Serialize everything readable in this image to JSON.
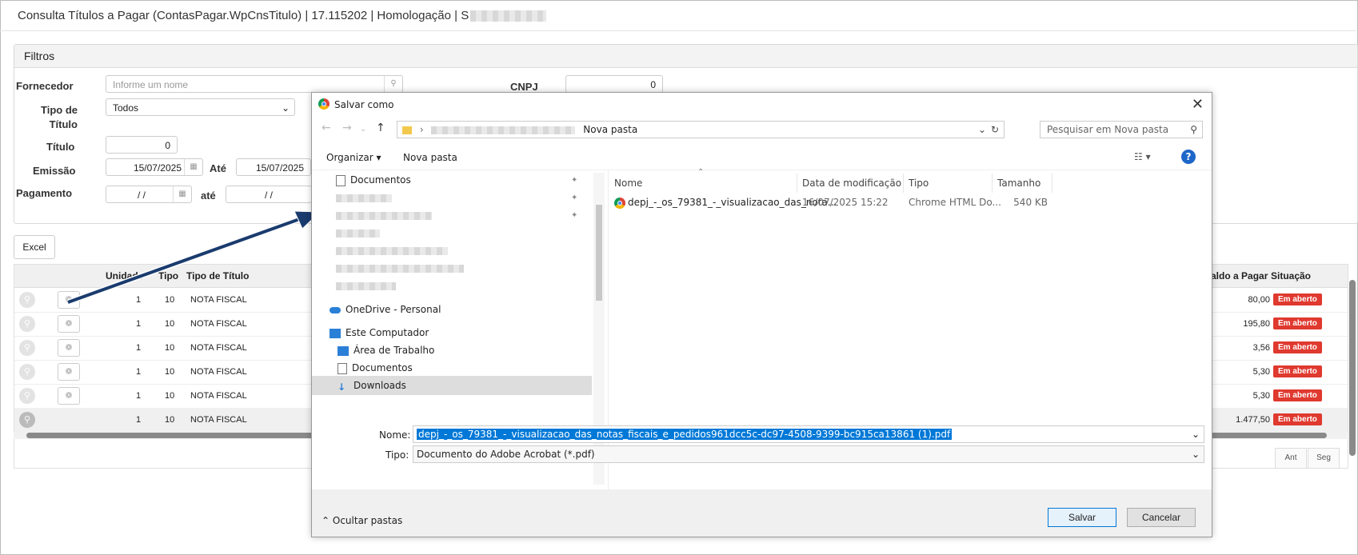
{
  "page": {
    "title": "Consulta Títulos a Pagar (ContasPagar.WpCnsTitulo) | 17.115202 | Homologação | S"
  },
  "filters": {
    "heading": "Filtros",
    "fornecedor_label": "Fornecedor",
    "fornecedor_placeholder": "Informe um nome",
    "cnpj_label": "CNPJ",
    "cnpj_value": "0",
    "tipo_label": "Tipo de Título",
    "tipo_value": "Todos",
    "titulo_label": "Título",
    "titulo_value": "0",
    "emissao_label": "Emissão",
    "emissao_from": "15/07/2025",
    "ate_label": "Até",
    "emissao_to": "15/07/2025",
    "pagamento_label": "Pagamento",
    "pagamento_from": " / /",
    "ate2_label": "até",
    "pagamento_to": " / /"
  },
  "grid": {
    "excel_label": "Excel",
    "headers": [
      "Unidade",
      "Tipo",
      "Tipo de Título",
      "Saldo a Pagar",
      "Situação"
    ],
    "rows": [
      {
        "unidade": "1",
        "tipo": "10",
        "tipo_titulo": "NOTA FISCAL",
        "saldo": "80,00",
        "situacao": "Em aberto"
      },
      {
        "unidade": "1",
        "tipo": "10",
        "tipo_titulo": "NOTA FISCAL",
        "saldo": "195,80",
        "situacao": "Em aberto"
      },
      {
        "unidade": "1",
        "tipo": "10",
        "tipo_titulo": "NOTA FISCAL",
        "saldo": "3,56",
        "situacao": "Em aberto"
      },
      {
        "unidade": "1",
        "tipo": "10",
        "tipo_titulo": "NOTA FISCAL",
        "saldo": "5,30",
        "situacao": "Em aberto"
      },
      {
        "unidade": "1",
        "tipo": "10",
        "tipo_titulo": "NOTA FISCAL",
        "saldo": "5,30",
        "situacao": "Em aberto"
      },
      {
        "unidade": "1",
        "tipo": "10",
        "tipo_titulo": "NOTA FISCAL",
        "saldo": "1.477,50",
        "situacao": "Em aberto"
      }
    ],
    "pager_prev": "Ant",
    "pager_next": "Seg"
  },
  "dialog": {
    "title": "Salvar como",
    "path_last": "Nova pasta",
    "search_placeholder": "Pesquisar em Nova pasta",
    "organizar": "Organizar",
    "nova_pasta": "Nova pasta",
    "tree": {
      "documentos": "Documentos",
      "onedrive": "OneDrive - Personal",
      "este_computador": "Este Computador",
      "area_trabalho": "Área de Trabalho",
      "documentos2": "Documentos",
      "downloads": "Downloads"
    },
    "columns": [
      "Nome",
      "Data de modificação",
      "Tipo",
      "Tamanho"
    ],
    "file": {
      "name": "depj_-_os_79381_-_visualizacao_das_nota...",
      "date": "16/07/2025 15:22",
      "type": "Chrome HTML Do...",
      "size": "540 KB"
    },
    "nome_label": "Nome:",
    "nome_value": "depj_-_os_79381_-_visualizacao_das_notas_fiscais_e_pedidos961dcc5c-dc97-4508-9399-bc915ca13861 (1).pdf",
    "tipo_label": "Tipo:",
    "tipo_value": "Documento do Adobe Acrobat (*.pdf)",
    "ocultar": "Ocultar pastas",
    "salvar": "Salvar",
    "cancelar": "Cancelar"
  }
}
